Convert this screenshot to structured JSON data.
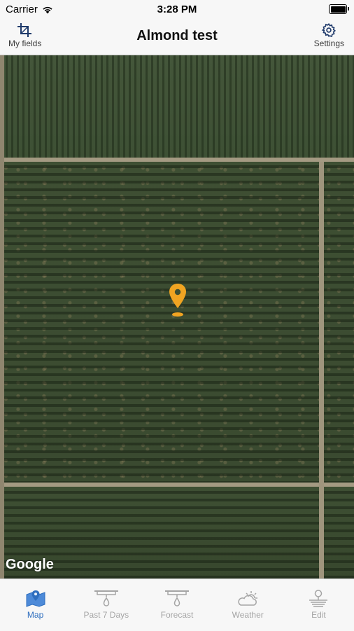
{
  "status_bar": {
    "carrier": "Carrier",
    "time": "3:28 PM"
  },
  "nav": {
    "title": "Almond test",
    "left_label": "My fields",
    "left_icon": "crop-icon",
    "right_label": "Settings",
    "right_icon": "gear-icon"
  },
  "map": {
    "attribution": "Google",
    "marker_color": "#f0a422"
  },
  "tabs": [
    {
      "label": "Map",
      "icon": "map-icon",
      "active": true
    },
    {
      "label": "Past 7 Days",
      "icon": "irrigation-icon",
      "active": false
    },
    {
      "label": "Forecast",
      "icon": "irrigation-forecast-icon",
      "active": false
    },
    {
      "label": "Weather",
      "icon": "cloud-sun-icon",
      "active": false
    },
    {
      "label": "Edit",
      "icon": "edit-field-icon",
      "active": false
    }
  ],
  "colors": {
    "accent": "#2f6fbf",
    "inactive": "#a5a5a5"
  }
}
